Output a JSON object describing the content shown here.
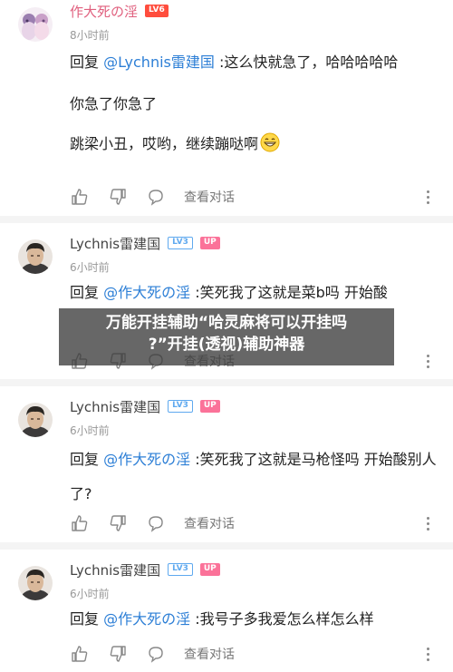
{
  "comments": [
    {
      "username": "作大死の淫",
      "level": "LV6",
      "time": "8小时前",
      "lines": [
        "回复 ",
        "@Lychnis雷建国",
        " :这么快就急了，哈哈哈哈哈",
        "你急了你急了",
        "跳梁小丑，哎哟，继续蹦哒啊"
      ],
      "view_replies": "查看对话"
    },
    {
      "username": "Lychnis雷建国",
      "level": "LV3",
      "up_badge": "UP",
      "time": "6小时前",
      "lines": [
        "回复 ",
        "@作大死の淫",
        " :笑死我了这就是菜b吗 开始酸"
      ],
      "view_replies": "查看对话"
    },
    {
      "username": "Lychnis雷建国",
      "level": "LV3",
      "up_badge": "UP",
      "time": "6小时前",
      "lines": [
        "回复 ",
        "@作大死の淫",
        " :笑死我了这就是马枪怪吗 开始酸别人了?"
      ],
      "view_replies": "查看对话"
    },
    {
      "username": "Lychnis雷建国",
      "level": "LV3",
      "up_badge": "UP",
      "time": "6小时前",
      "lines": [
        "回复 ",
        "@作大死の淫",
        " :我号子多我爱怎么样怎么样"
      ],
      "view_replies": "查看对话"
    }
  ],
  "overlay": {
    "line1": "万能开挂辅助“哈灵麻将可以开挂吗",
    "line2": "?”开挂(透视)辅助神器"
  },
  "colors": {
    "mention": "#2d7fd6",
    "accent_name": "#e0607e",
    "lv6": "#ff4d3d",
    "lv3": "#5fa9ef",
    "up": "#fb7299"
  },
  "icons": [
    "like-icon",
    "dislike-icon",
    "reply-icon",
    "more-icon",
    "grin-emoji-icon"
  ]
}
